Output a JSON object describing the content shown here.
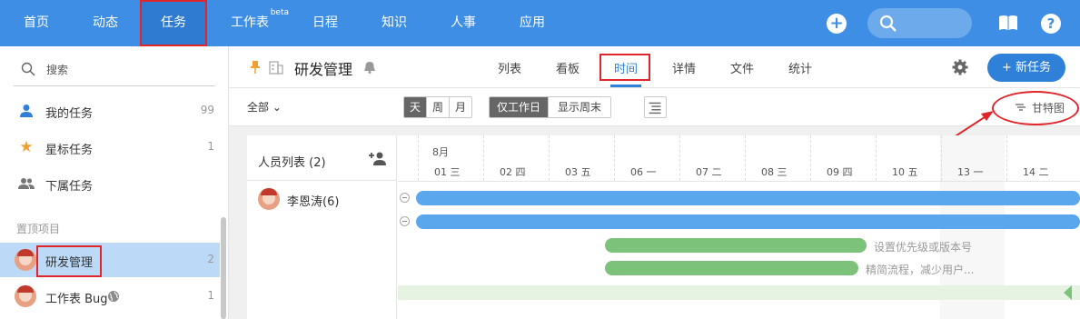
{
  "nav": {
    "items": [
      "首页",
      "动态",
      "任务",
      "工作表",
      "日程",
      "知识",
      "人事",
      "应用"
    ],
    "beta": "beta"
  },
  "sidebar": {
    "search_placeholder": "搜索",
    "items": [
      {
        "label": "我的任务",
        "count": "99"
      },
      {
        "label": "星标任务",
        "count": "1"
      },
      {
        "label": "下属任务",
        "count": ""
      }
    ],
    "section_title": "置顶项目",
    "projects": [
      {
        "label": "研发管理",
        "count": "2"
      },
      {
        "label": "工作表 Bug",
        "count": "1"
      }
    ]
  },
  "header": {
    "title": "研发管理",
    "tabs": [
      "列表",
      "看板",
      "时间",
      "详情",
      "文件",
      "统计"
    ],
    "active_tab": "时间",
    "new_task": "+ 新任务"
  },
  "toolbar": {
    "filter": "全部",
    "scale": [
      "天",
      "周",
      "月"
    ],
    "days": [
      "仅工作日",
      "显示周末"
    ],
    "gantt": "甘特图"
  },
  "gantt": {
    "people_title": "人员列表 (2)",
    "person_name": "李恩涛(6)",
    "month": "8月",
    "days": [
      "01 三",
      "02 四",
      "03 五",
      "06 一",
      "07 二",
      "08 三",
      "09 四",
      "10 五",
      "13 一",
      "14 二"
    ],
    "tasks": [
      "设置优先级或版本号",
      "精简流程，减少用户..."
    ]
  },
  "colors": {
    "accent": "#3d8ee4",
    "primary": "#2f80d8",
    "highlight": "#e0262b",
    "bar_blue": "#5aa7ee",
    "bar_green": "#7dc27a"
  }
}
